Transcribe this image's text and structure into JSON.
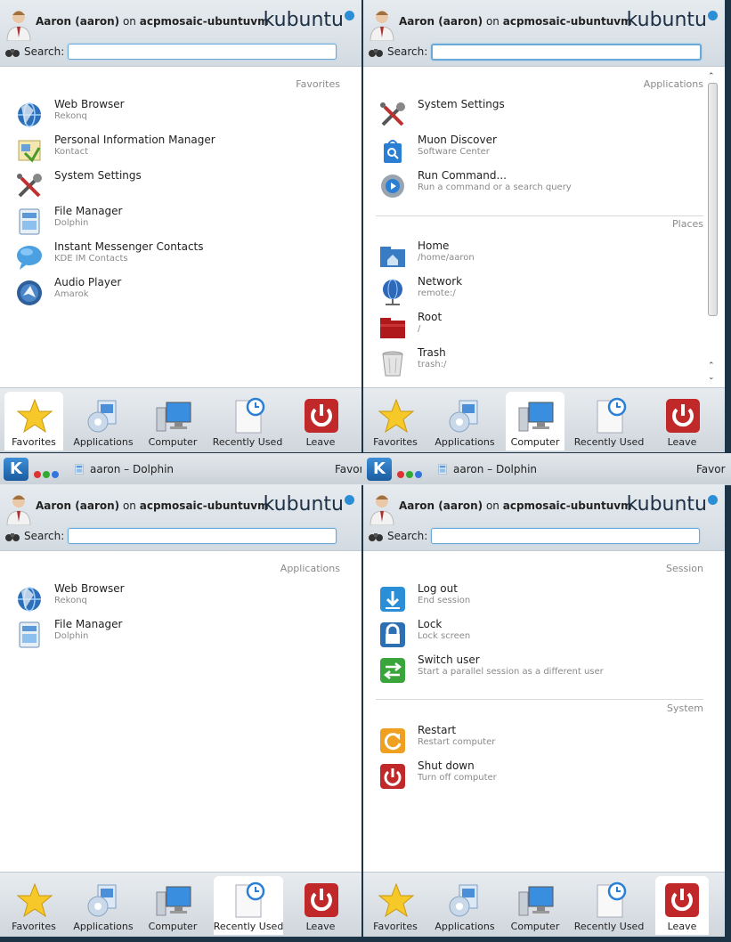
{
  "user": {
    "name": "Aaron (aaron)",
    "on": "on",
    "host": "acpmosaic-ubuntuvm"
  },
  "logo_text": "kubuntu",
  "search_label": "Search:",
  "tabs": {
    "favorites": "Favorites",
    "applications": "Applications",
    "computer": "Computer",
    "recently_used": "Recently Used",
    "leave": "Leave"
  },
  "panel_favorites": {
    "section": "Favorites",
    "items": [
      {
        "title": "Web Browser",
        "subtitle": "Rekonq",
        "icon": "web-browser-icon"
      },
      {
        "title": "Personal Information Manager",
        "subtitle": "Kontact",
        "icon": "kontact-icon"
      },
      {
        "title": "System Settings",
        "subtitle": "",
        "icon": "system-settings-icon"
      },
      {
        "title": "File Manager",
        "subtitle": "Dolphin",
        "icon": "file-manager-icon"
      },
      {
        "title": "Instant Messenger Contacts",
        "subtitle": "KDE IM Contacts",
        "icon": "im-contacts-icon"
      },
      {
        "title": "Audio Player",
        "subtitle": "Amarok",
        "icon": "audio-player-icon"
      }
    ]
  },
  "panel_computer": {
    "section_apps": "Applications",
    "apps": [
      {
        "title": "System Settings",
        "subtitle": "",
        "icon": "system-settings-icon"
      },
      {
        "title": "Muon Discover",
        "subtitle": "Software Center",
        "icon": "software-center-icon"
      },
      {
        "title": "Run Command...",
        "subtitle": "Run a command or a search query",
        "icon": "run-command-icon"
      }
    ],
    "section_places": "Places",
    "places": [
      {
        "title": "Home",
        "subtitle": "/home/aaron",
        "icon": "home-folder-icon"
      },
      {
        "title": "Network",
        "subtitle": "remote:/",
        "icon": "network-icon"
      },
      {
        "title": "Root",
        "subtitle": "/",
        "icon": "root-folder-icon"
      },
      {
        "title": "Trash",
        "subtitle": "trash:/",
        "icon": "trash-icon"
      }
    ]
  },
  "panel_recent": {
    "section": "Applications",
    "items": [
      {
        "title": "Web Browser",
        "subtitle": "Rekonq",
        "icon": "web-browser-icon"
      },
      {
        "title": "File Manager",
        "subtitle": "Dolphin",
        "icon": "file-manager-icon"
      }
    ]
  },
  "panel_leave": {
    "section_session": "Session",
    "session": [
      {
        "title": "Log out",
        "subtitle": "End session",
        "icon": "logout-icon"
      },
      {
        "title": "Lock",
        "subtitle": "Lock screen",
        "icon": "lock-icon"
      },
      {
        "title": "Switch user",
        "subtitle": "Start a parallel session as a different user",
        "icon": "switch-user-icon"
      }
    ],
    "section_system": "System",
    "system": [
      {
        "title": "Restart",
        "subtitle": "Restart computer",
        "icon": "restart-icon"
      },
      {
        "title": "Shut down",
        "subtitle": "Turn off computer",
        "icon": "shutdown-icon"
      }
    ]
  },
  "taskbar": {
    "window_title": "aaron – Dolphin",
    "favorites_clip": "Favor"
  },
  "colors": {
    "accent": "#2a8fd6",
    "red": "#c0282a",
    "taskbar_bg": "#d6dde3"
  }
}
